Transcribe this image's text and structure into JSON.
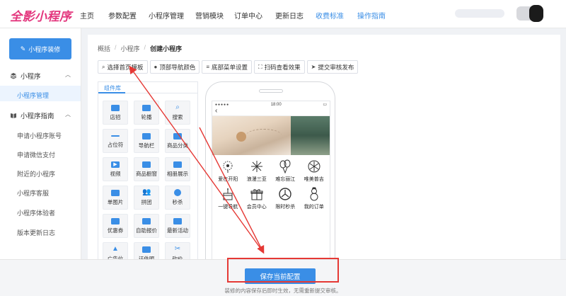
{
  "header": {
    "logo": "全影小程序",
    "nav": [
      {
        "label": "主页",
        "highlight": false
      },
      {
        "label": "参数配置",
        "highlight": false
      },
      {
        "label": "小程序管理",
        "highlight": false
      },
      {
        "label": "营销模块",
        "highlight": false
      },
      {
        "label": "订单中心",
        "highlight": false
      },
      {
        "label": "更新日志",
        "highlight": false
      },
      {
        "label": "收费标准",
        "highlight": true
      },
      {
        "label": "操作指南",
        "highlight": true
      }
    ]
  },
  "sidebar": {
    "button_label": "小程序装修",
    "sections": [
      {
        "label": "小程序",
        "expanded": true,
        "icon": "layers-icon"
      },
      {
        "label": "小程序指南",
        "expanded": true,
        "icon": "book-icon"
      }
    ],
    "active_item": "小程序管理",
    "guide_items": [
      "申请小程序账号",
      "申请微信支付",
      "附近的小程序",
      "小程序客服",
      "小程序体验者",
      "版本更新日志"
    ]
  },
  "breadcrumb": {
    "items": [
      "概括",
      "小程序",
      "创建小程序"
    ]
  },
  "toolbar": {
    "buttons": [
      {
        "label": "选择首页模板",
        "icon": "search-icon"
      },
      {
        "label": "顶部导航颜色",
        "icon": "palette-icon"
      },
      {
        "label": "底部菜单设置",
        "icon": "menu-icon"
      },
      {
        "label": "扫码查看效果",
        "icon": "scan-icon"
      },
      {
        "label": "提交审核发布",
        "icon": "send-icon"
      }
    ]
  },
  "library": {
    "tab": "组件库",
    "components": [
      {
        "label": "店招",
        "icon": "store-icon"
      },
      {
        "label": "轮播",
        "icon": "carousel-icon"
      },
      {
        "label": "搜索",
        "icon": "search-icon"
      },
      {
        "label": "占位符",
        "icon": "placeholder-icon"
      },
      {
        "label": "导航栏",
        "icon": "navbar-icon"
      },
      {
        "label": "商品分类",
        "icon": "category-icon"
      },
      {
        "label": "视频",
        "icon": "video-icon"
      },
      {
        "label": "商品橱窗",
        "icon": "showcase-icon"
      },
      {
        "label": "相册展示",
        "icon": "album-icon"
      },
      {
        "label": "单图片",
        "icon": "image-icon"
      },
      {
        "label": "拼团",
        "icon": "group-buy-icon"
      },
      {
        "label": "秒杀",
        "icon": "flash-sale-icon"
      },
      {
        "label": "优惠券",
        "icon": "coupon-icon"
      },
      {
        "label": "自助报价",
        "icon": "quote-icon"
      },
      {
        "label": "最新活动",
        "icon": "activity-icon"
      },
      {
        "label": "广告位",
        "icon": "ad-icon"
      },
      {
        "label": "证件照",
        "icon": "id-photo-icon"
      },
      {
        "label": "砍价",
        "icon": "bargain-icon"
      }
    ]
  },
  "phone": {
    "time": "18:00",
    "grid": [
      {
        "label": "爱在开阳",
        "icon": "dandelion-icon"
      },
      {
        "label": "浪漫三亚",
        "icon": "fireworks-icon"
      },
      {
        "label": "难忘丽江",
        "icon": "balloons-icon"
      },
      {
        "label": "唯美普吉",
        "icon": "snowflake-icon"
      },
      {
        "label": "一键导航",
        "icon": "cake-icon"
      },
      {
        "label": "会员中心",
        "icon": "gift-icon"
      },
      {
        "label": "限时秒杀",
        "icon": "clock-icon"
      },
      {
        "label": "我的订单",
        "icon": "snowman-icon"
      }
    ]
  },
  "footer": {
    "save_label": "保存当前配置",
    "hint": "装修的内容保存后即时生效，无需重新提交审核。"
  },
  "colors": {
    "primary": "#3a8ee6",
    "logo": "#e3367d",
    "annotation": "#e53935"
  }
}
